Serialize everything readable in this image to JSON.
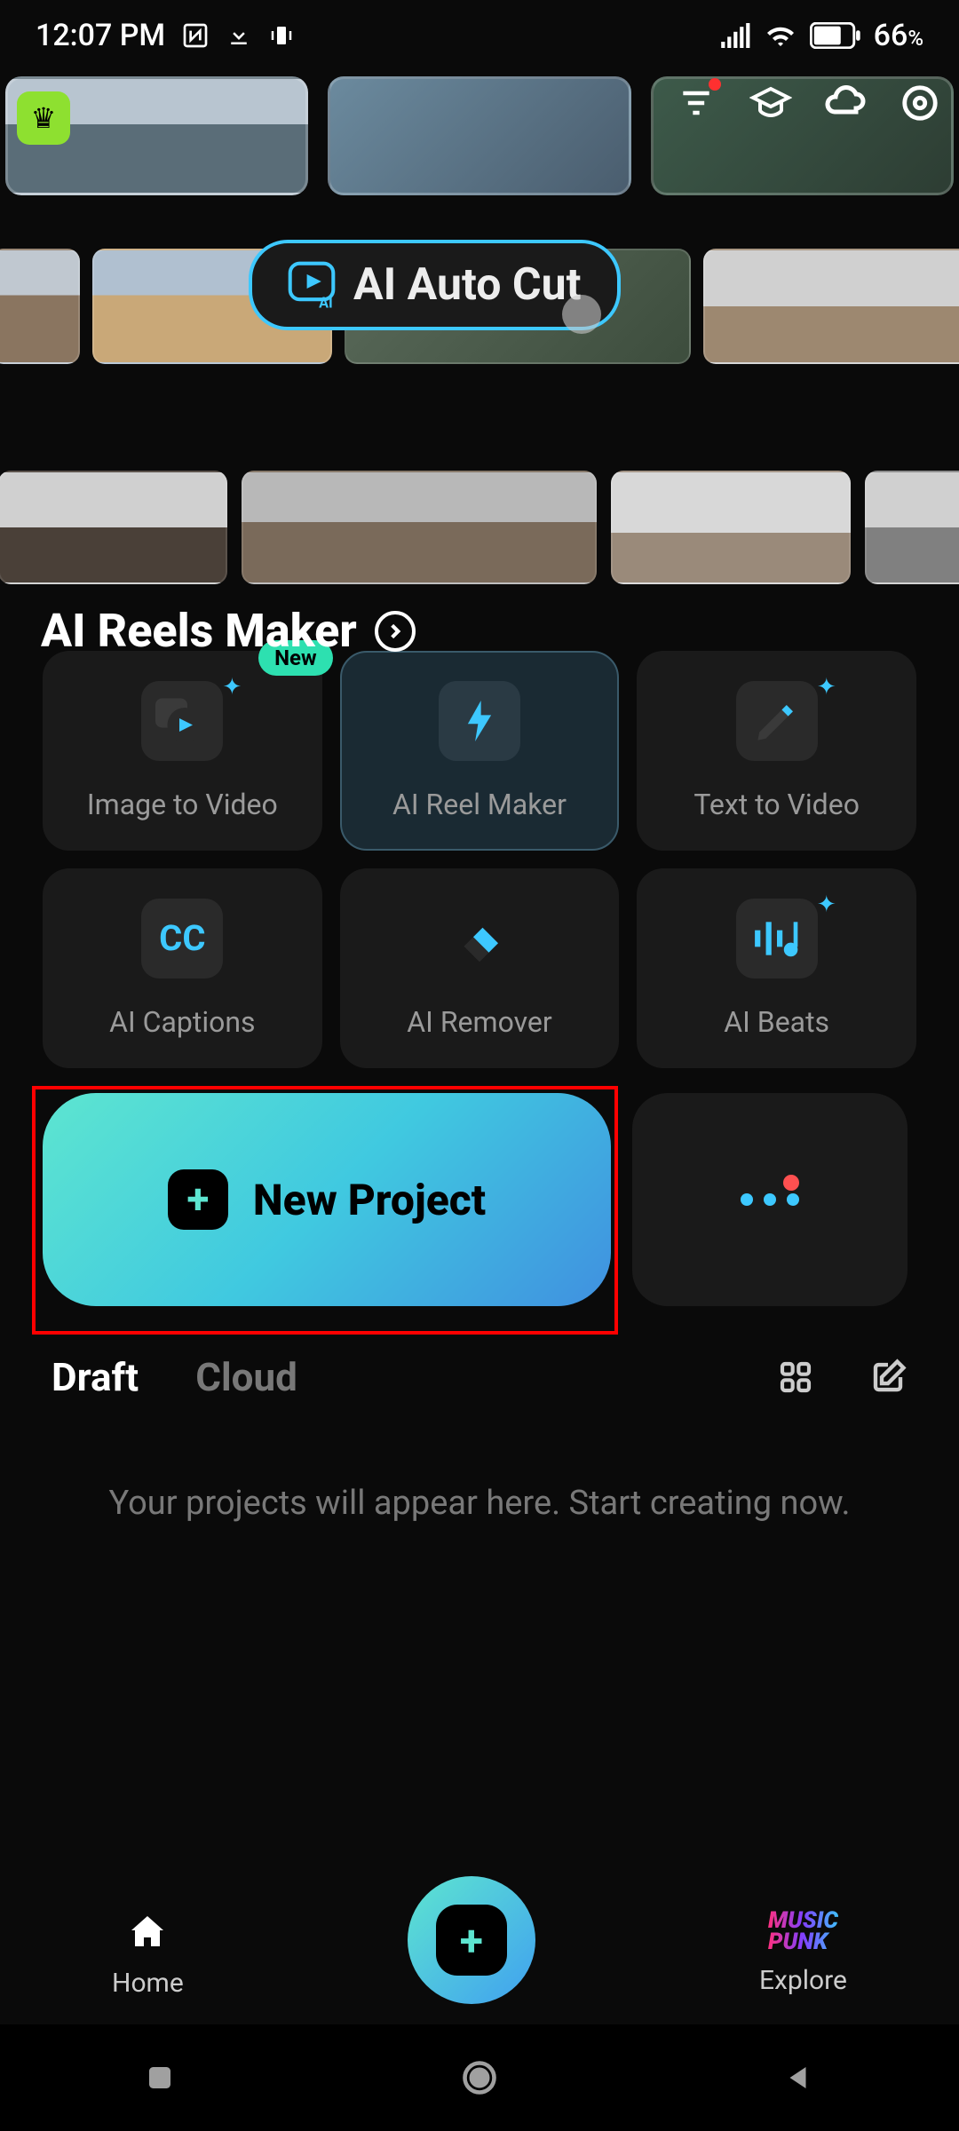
{
  "status_bar": {
    "time": "12:07 PM",
    "battery": "66",
    "battery_pct": "%"
  },
  "top_icons": {
    "filter": "filter-icon",
    "graduation": "graduation-icon",
    "cloud": "cloud-icon",
    "search": "search-icon"
  },
  "ai_auto_cut": {
    "label": "AI Auto Cut"
  },
  "section": {
    "title": "AI Reels Maker"
  },
  "features": [
    {
      "label": "Image to Video",
      "badge": "New",
      "icon": "image-video"
    },
    {
      "label": "AI Reel Maker",
      "icon": "bolt"
    },
    {
      "label": "Text to Video",
      "icon": "pencil"
    },
    {
      "label": "AI Captions",
      "icon": "CC"
    },
    {
      "label": "AI Remover",
      "icon": "eraser"
    },
    {
      "label": "AI Beats",
      "icon": "beats"
    }
  ],
  "new_project": {
    "label": "New Project"
  },
  "tabs": {
    "draft": "Draft",
    "cloud": "Cloud"
  },
  "empty_message": "Your projects will appear here. Start creating now.",
  "bottom_nav": {
    "home": "Home",
    "explore": "Explore",
    "music_line1": "MUSIC",
    "music_line2": "PUNK"
  }
}
